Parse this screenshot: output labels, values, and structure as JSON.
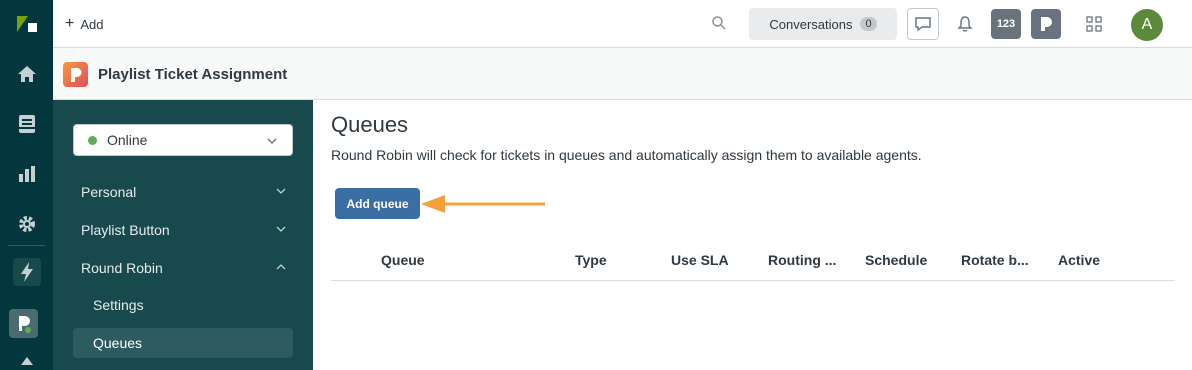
{
  "topbar": {
    "add_label": "Add",
    "conversations_label": "Conversations",
    "conversations_count": "0",
    "app_badge": "123",
    "avatar_initial": "A"
  },
  "app": {
    "title": "Playlist Ticket Assignment"
  },
  "sidebar": {
    "status": "Online",
    "items": [
      {
        "label": "Personal"
      },
      {
        "label": "Playlist Button"
      },
      {
        "label": "Round Robin"
      }
    ],
    "subitems": [
      {
        "label": "Settings"
      },
      {
        "label": "Queues"
      }
    ]
  },
  "main": {
    "title": "Queues",
    "description": "Round Robin will check for tickets in queues and automatically assign them to available agents.",
    "add_button": "Add queue",
    "columns": [
      "Queue",
      "Type",
      "Use SLA",
      "Routing ...",
      "Schedule",
      "Rotate b...",
      "Active"
    ]
  },
  "colors": {
    "rail_bg": "#03363d",
    "sidenav_bg": "#17494d",
    "primary_button": "#3a6ea5",
    "annotation_arrow": "#f5a03a",
    "status_online": "#5eae53",
    "avatar_bg": "#5c8a3a"
  },
  "icons": [
    "zendesk-logo-icon",
    "home-icon",
    "views-icon",
    "reporting-icon",
    "admin-gear-icon",
    "lightning-icon",
    "playlist-app-icon",
    "upload-icon",
    "search-icon",
    "chat-icon",
    "bell-icon",
    "apps-grid-icon",
    "chevron-down-icon",
    "chevron-up-icon"
  ]
}
